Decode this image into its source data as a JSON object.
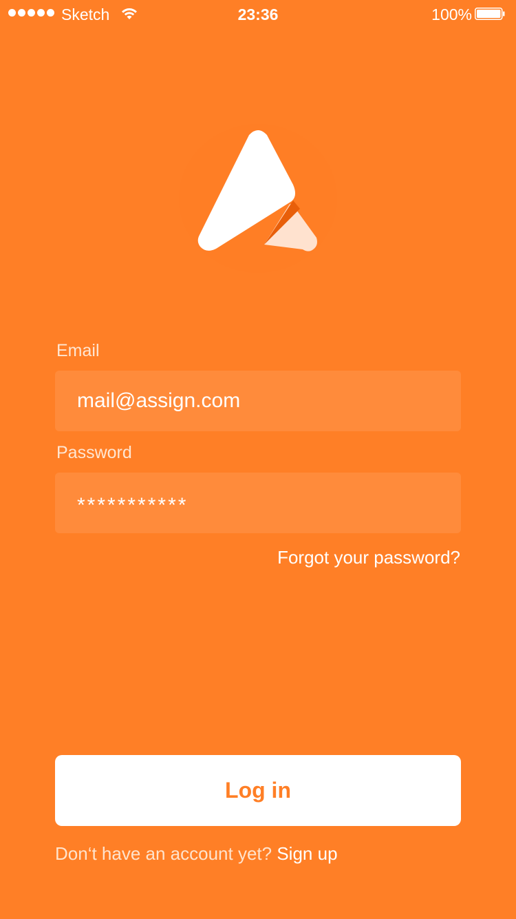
{
  "status_bar": {
    "carrier": "Sketch",
    "time": "23:36",
    "battery_percent": "100%",
    "signal_bars": 5,
    "icons": [
      "signal-dots-icon",
      "wifi-icon",
      "battery-icon"
    ]
  },
  "logo": {
    "icon": "app-logo-icon"
  },
  "form": {
    "email_label": "Email",
    "email_value": "mail@assign.com",
    "password_label": "Password",
    "password_value": "***********",
    "forgot_link": "Forgot your password?"
  },
  "actions": {
    "login_label": "Log in",
    "signup_prompt": "Don‘t have an account yet?",
    "signup_link": "Sign up"
  },
  "colors": {
    "background": "#FF7F26",
    "input_background": "#FF8B3B",
    "button_background": "#FFFFFF",
    "button_text": "#FF7F26",
    "logo_accent": "#FFE2CF"
  }
}
